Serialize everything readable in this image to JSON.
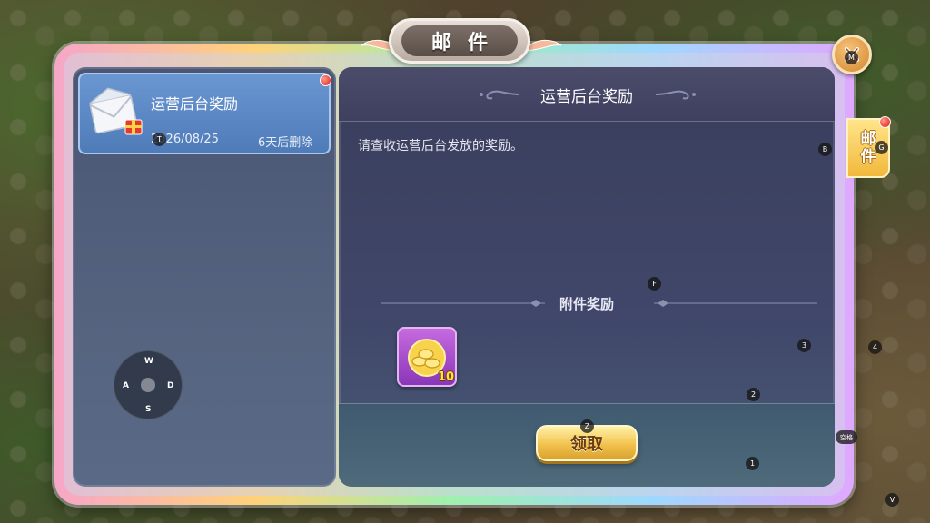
{
  "window": {
    "title": "邮件",
    "title_chars": [
      "邮",
      "件"
    ]
  },
  "mail_list": {
    "items": [
      {
        "title": "运营后台奖励",
        "date": "2026/08/25",
        "expire": "6天后删除",
        "unread": true,
        "selected": true,
        "icon": "envelope-gift-icon"
      }
    ]
  },
  "mail_detail": {
    "title": "运营后台奖励",
    "body": "请查收运营后台发放的奖励。",
    "attachments_title": "附件奖励",
    "attachments": [
      {
        "icon": "gold-ingot-icon",
        "count": "10"
      }
    ],
    "claim_button": "领取"
  },
  "side_tabs": [
    {
      "label_line1": "邮",
      "label_line2": "件",
      "badge": true
    }
  ],
  "close_button": {
    "icon": "close-icon",
    "key": "M"
  },
  "key_hints": {
    "item_key": "T",
    "body_key": "B",
    "tab_key": "G",
    "divider_key": "F",
    "slot_key_3": "3",
    "slot_key_4": "4",
    "slot_key_2": "2",
    "claim_key": "Z",
    "slot_key_1": "1",
    "space_key": "空格",
    "v_key": "V"
  },
  "joystick": {
    "up": "W",
    "left": "A",
    "down": "S",
    "right": "D"
  },
  "colors": {
    "accent_gold": "#f2c24e",
    "selected_item": "#4f7bb8",
    "reward_purple": "#8a36b8",
    "badge_red": "#e01a10"
  }
}
